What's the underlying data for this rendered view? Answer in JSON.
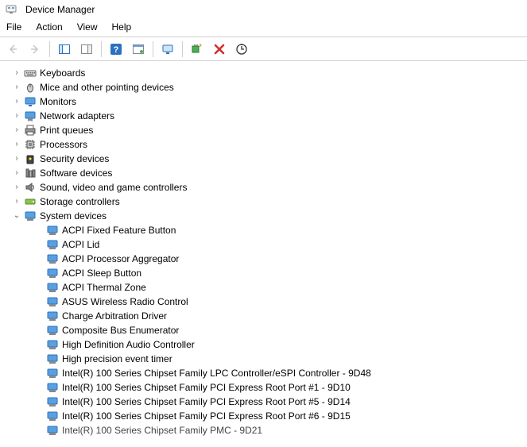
{
  "window": {
    "title": "Device Manager"
  },
  "menu": {
    "file": "File",
    "action": "Action",
    "view": "View",
    "help": "Help"
  },
  "toolbar": {
    "back": "Back",
    "forward": "Forward",
    "show_hide_tree": "Show/Hide Console Tree",
    "properties": "Properties",
    "help": "Help",
    "action_icons": "Actions",
    "monitor": "Update Driver",
    "add_legacy": "Add legacy hardware",
    "uninstall": "Uninstall device",
    "scan": "Scan for hardware changes"
  },
  "tree": {
    "categories": [
      {
        "icon": "keyboard-icon",
        "label": "Keyboards",
        "expanded": false
      },
      {
        "icon": "mouse-icon",
        "label": "Mice and other pointing devices",
        "expanded": false
      },
      {
        "icon": "monitor-icon",
        "label": "Monitors",
        "expanded": false
      },
      {
        "icon": "network-icon",
        "label": "Network adapters",
        "expanded": false
      },
      {
        "icon": "printer-icon",
        "label": "Print queues",
        "expanded": false
      },
      {
        "icon": "cpu-icon",
        "label": "Processors",
        "expanded": false
      },
      {
        "icon": "security-icon",
        "label": "Security devices",
        "expanded": false
      },
      {
        "icon": "software-icon",
        "label": "Software devices",
        "expanded": false
      },
      {
        "icon": "sound-icon",
        "label": "Sound, video and game controllers",
        "expanded": false
      },
      {
        "icon": "storage-icon",
        "label": "Storage controllers",
        "expanded": false
      },
      {
        "icon": "system-icon",
        "label": "System devices",
        "expanded": true,
        "children": [
          "ACPI Fixed Feature Button",
          "ACPI Lid",
          "ACPI Processor Aggregator",
          "ACPI Sleep Button",
          "ACPI Thermal Zone",
          "ASUS Wireless Radio Control",
          "Charge Arbitration Driver",
          "Composite Bus Enumerator",
          "High Definition Audio Controller",
          "High precision event timer",
          "Intel(R) 100 Series Chipset Family LPC Controller/eSPI Controller - 9D48",
          "Intel(R) 100 Series Chipset Family PCI Express Root Port #1 - 9D10",
          "Intel(R) 100 Series Chipset Family PCI Express Root Port #5 - 9D14",
          "Intel(R) 100 Series Chipset Family PCI Express Root Port #6 - 9D15",
          "Intel(R) 100 Series Chipset Family PMC - 9D21"
        ]
      }
    ]
  }
}
